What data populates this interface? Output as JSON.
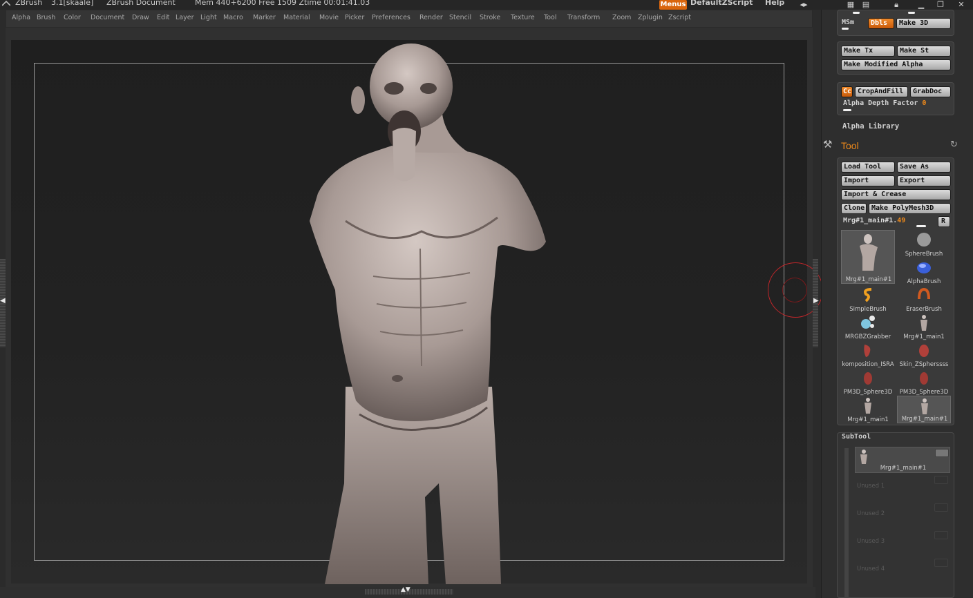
{
  "titlebar": {
    "app_name": "ZBrush",
    "version": "3.1[skaale]",
    "document": "ZBrush Document",
    "stats": "Mem 440+6200  Free 1509  Ztime 00:01:41.03",
    "menus_button": "Menus",
    "script_name": "DefaultZScript",
    "help": "Help"
  },
  "menubar": {
    "items": [
      "Alpha",
      "Brush",
      "Color",
      "Document",
      "Draw",
      "Edit",
      "Layer",
      "Light",
      "Macro",
      "Marker",
      "Material",
      "Movie",
      "Picker",
      "Preferences",
      "Render",
      "Stencil",
      "Stroke",
      "Texture",
      "Tool",
      "Transform",
      "Zoom",
      "Zplugin",
      "Zscript"
    ]
  },
  "alpha_panel": {
    "msm_label": "MSm",
    "dbls_label": "Dbls",
    "make3d_label": "Make 3D",
    "make_tx_label": "Make Tx",
    "make_st_label": "Make St",
    "make_modified_alpha_label": "Make Modified Alpha",
    "cc_label": "Cc",
    "crop_and_fill_label": "CropAndFill",
    "grabdoc_label": "GrabDoc",
    "alpha_depth_label": "Alpha Depth Factor",
    "alpha_depth_value": "0",
    "alpha_library_label": "Alpha Library"
  },
  "tool_panel": {
    "title": "Tool",
    "load_tool_label": "Load Tool",
    "save_as_label": "Save As",
    "import_label": "Import",
    "export_label": "Export",
    "import_crease_label": "Import & Crease",
    "clone_label": "Clone",
    "make_polymesh_label": "Make PolyMesh3D",
    "current_tool_name": "Mrg#1_main#1.",
    "current_tool_value": "49",
    "r_button_label": "R",
    "tools": [
      {
        "name": "Mrg#1_main#1",
        "icon": "figure-icon",
        "selected": true
      },
      {
        "name": "SphereBrush",
        "icon": "sphere-brush-icon",
        "selected": false
      },
      {
        "name": "AlphaBrush",
        "icon": "alpha-brush-icon",
        "selected": false
      },
      {
        "name": "SimpleBrush",
        "icon": "simple-brush-icon",
        "selected": false
      },
      {
        "name": "EraserBrush",
        "icon": "eraser-brush-icon",
        "selected": false
      },
      {
        "name": "MRGBZGrabber",
        "icon": "mrgbz-grabber-icon",
        "selected": false
      },
      {
        "name": "Mrg#1_main1",
        "icon": "figure-icon",
        "selected": false
      },
      {
        "name": "komposition_ISRA",
        "icon": "red-mesh-icon",
        "selected": false
      },
      {
        "name": "Skin_ZSpherssss",
        "icon": "red-mesh-icon",
        "selected": false
      },
      {
        "name": "PM3D_Sphere3D",
        "icon": "red-mesh-icon",
        "selected": false
      },
      {
        "name": "PM3D_Sphere3D",
        "icon": "red-mesh-icon",
        "selected": false
      },
      {
        "name": "Mrg#1_main1",
        "icon": "figure-icon",
        "selected": false
      },
      {
        "name": "Mrg#1_main#1",
        "icon": "figure-icon",
        "selected": true
      }
    ]
  },
  "subtool_panel": {
    "title": "SubTool",
    "active_name": "Mrg#1_main#1",
    "empty_slots": [
      "Unused 1",
      "Unused 2",
      "Unused 3",
      "Unused 4"
    ]
  },
  "colors": {
    "accent": "#f08a1a",
    "brush_cursor": "#c0262a",
    "background": "#2b2b2b"
  }
}
